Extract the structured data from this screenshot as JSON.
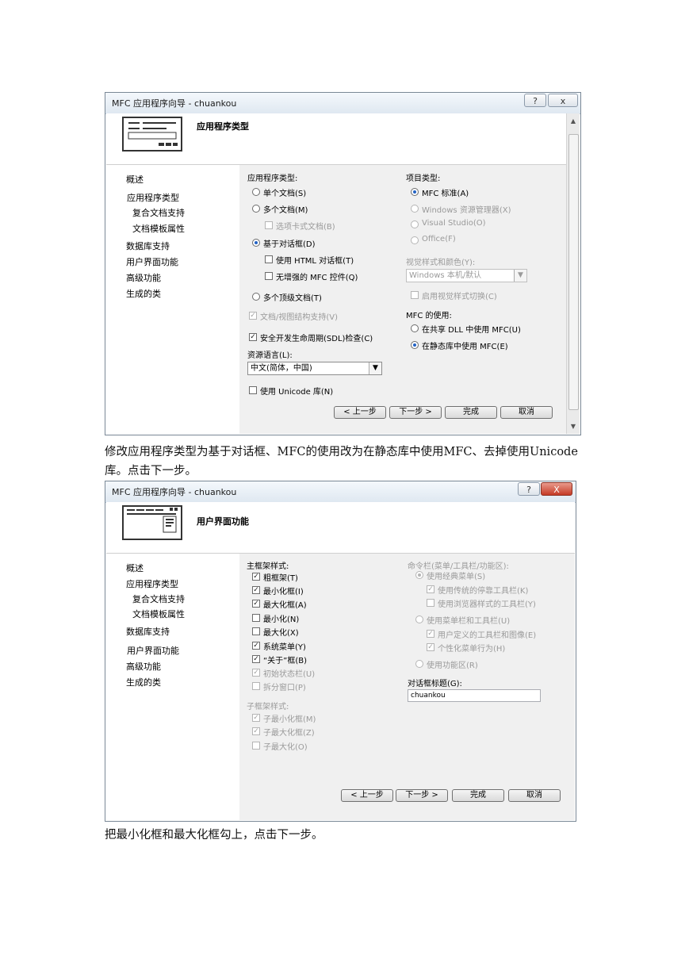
{
  "dialog1": {
    "title": "MFC 应用程序向导 - chuankou",
    "help_glyph": "?",
    "close_glyph": "x",
    "header_title": "应用程序类型",
    "nav": [
      "概述",
      "应用程序类型",
      "复合文档支持",
      "文档模板属性",
      "数据库支持",
      "用户界面功能",
      "高级功能",
      "生成的类"
    ],
    "app_type_label": "应用程序类型:",
    "single_doc": "单个文档(S)",
    "multi_doc": "多个文档(M)",
    "tabbed_docs": "选项卡式文档(B)",
    "dialog_based": "基于对话框(D)",
    "use_html_dialog": "使用 HTML 对话框(T)",
    "no_enhanced_mfc": "无增强的 MFC 控件(Q)",
    "multi_top_level": "多个顶级文档(T)",
    "doc_view_support": "文档/视图结构支持(V)",
    "sdl_check": "安全开发生命周期(SDL)检查(C)",
    "resource_lang_label": "资源语言(L):",
    "resource_lang_value": "中文(简体，中国)",
    "use_unicode": "使用 Unicode 库(N)",
    "project_type_label": "项目类型:",
    "mfc_standard": "MFC 标准(A)",
    "windows_explorer": "Windows 资源管理器(X)",
    "visual_studio": "Visual Studio(O)",
    "office": "Office(F)",
    "visual_style_label": "视觉样式和颜色(Y):",
    "visual_style_value": "Windows 本机/默认",
    "enable_style_switch": "启用视觉样式切换(C)",
    "mfc_use_label": "MFC 的使用:",
    "mfc_shared_dll": "在共享 DLL 中使用 MFC(U)",
    "mfc_static_lib": "在静态库中使用 MFC(E)",
    "btn_prev": "< 上一步",
    "btn_next": "下一步 >",
    "btn_finish": "完成",
    "btn_cancel": "取消"
  },
  "caption1": "修改应用程序类型为基于对话框、MFC的使用改为在静态库中使用MFC、去掉使用Unicode库。点击下一步。",
  "dialog2": {
    "title": "MFC 应用程序向导 - chuankou",
    "help_glyph": "?",
    "close_glyph": "X",
    "header_title": "用户界面功能",
    "nav": [
      "概述",
      "应用程序类型",
      "复合文档支持",
      "文档模板属性",
      "数据库支持",
      "用户界面功能",
      "高级功能",
      "生成的类"
    ],
    "main_frame_label": "主框架样式:",
    "thick_frame": "粗框架(T)",
    "minimize_box": "最小化框(I)",
    "maximize_box": "最大化框(A)",
    "minimized": "最小化(N)",
    "maximized": "最大化(X)",
    "system_menu": "系统菜单(Y)",
    "about_box": "“关于”框(B)",
    "initial_status_bar": "初始状态栏(U)",
    "split_window": "拆分窗口(P)",
    "child_frame_label": "子框架样式:",
    "child_minimize": "子最小化框(M)",
    "child_maximize": "子最大化框(Z)",
    "child_maximized": "子最大化(O)",
    "command_bar_label": "命令栏(菜单/工具栏/功能区):",
    "classic_menu": "使用经典菜单(S)",
    "classic_docking_toolbar": "使用传统的停靠工具栏(K)",
    "browser_toolbar": "使用浏览器样式的工具栏(Y)",
    "menu_and_toolbar": "使用菜单栏和工具栏(U)",
    "user_defined_toolbar": "用户定义的工具栏和图像(E)",
    "personalized_menu": "个性化菜单行为(H)",
    "ribbon": "使用功能区(R)",
    "dialog_title_label": "对话框标题(G):",
    "dialog_title_value": "chuankou",
    "btn_prev": "< 上一步",
    "btn_next": "下一步 >",
    "btn_finish": "完成",
    "btn_cancel": "取消"
  },
  "caption2": "把最小化框和最大化框勾上，点击下一步。",
  "glyphs": {
    "check": "✓",
    "dropdown": "▼",
    "scroll_up": "▲",
    "scroll_down": "▼"
  }
}
